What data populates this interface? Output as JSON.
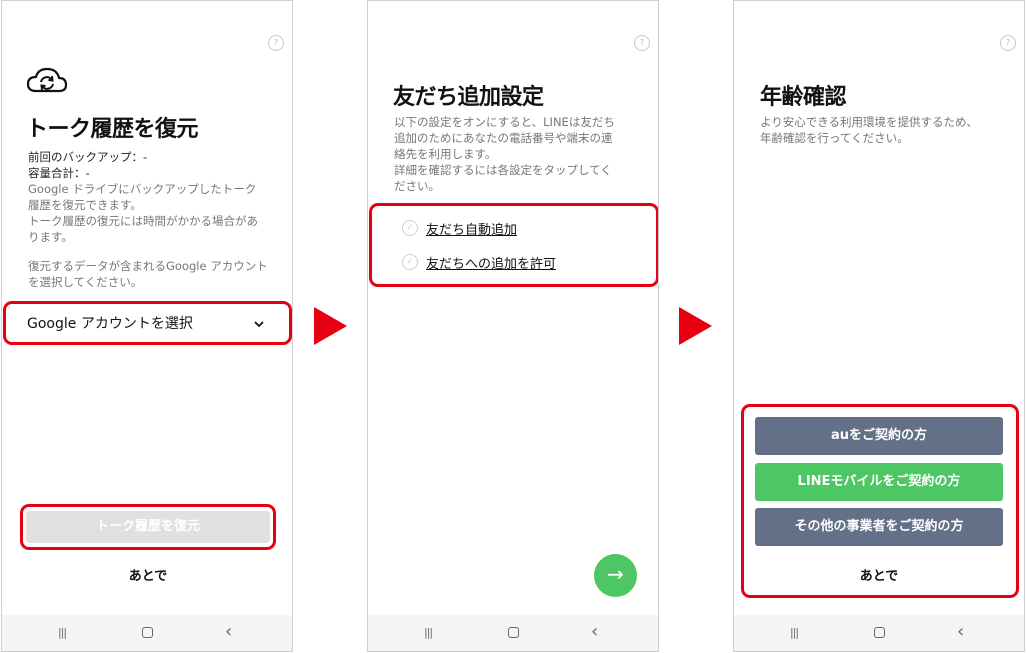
{
  "colors": {
    "accent_red": "#e60012",
    "line_green": "#4cc764",
    "carrier_gray": "#637087",
    "disabled_gray": "#e0e0e0"
  },
  "screen1": {
    "help_icon": "?",
    "title": "トーク履歴を復元",
    "last_backup": "前回のバックアップ：-",
    "total_size": "容量合計：-",
    "desc_line1": "Google ドライブにバックアップしたトーク",
    "desc_line2": "履歴を復元できます。",
    "desc_line3": "トーク履歴の復元には時間がかかる場合があ",
    "desc_line4": "ります。",
    "hint_line1": "復元するデータが含まれるGoogle アカウント",
    "hint_line2": "を選択してください。",
    "account_select_label": "Google アカウントを選択",
    "restore_button": "トーク履歴を復元",
    "later_button": "あとで"
  },
  "screen2": {
    "help_icon": "?",
    "title": "友だち追加設定",
    "desc_line1": "以下の設定をオンにすると、LINEは友だち",
    "desc_line2": "追加のためにあなたの電話番号や端末の連",
    "desc_line3": "絡先を利用します。",
    "desc_line4": "詳細を確認するには各設定をタップしてく",
    "desc_line5": "ださい。",
    "options": [
      {
        "label": "友だち自動追加",
        "checked": false
      },
      {
        "label": "友だちへの追加を許可",
        "checked": false
      }
    ],
    "next_icon": "→"
  },
  "screen3": {
    "help_icon": "?",
    "title": "年齢確認",
    "desc_line1": "より安心できる利用環境を提供するため、",
    "desc_line2": "年齢確認を行ってください。",
    "buttons": [
      "auをご契約の方",
      "LINEモバイルをご契約の方",
      "その他の事業者をご契約の方"
    ],
    "later_button": "あとで"
  },
  "navbar": {
    "recents": "|||",
    "back": "‹"
  }
}
